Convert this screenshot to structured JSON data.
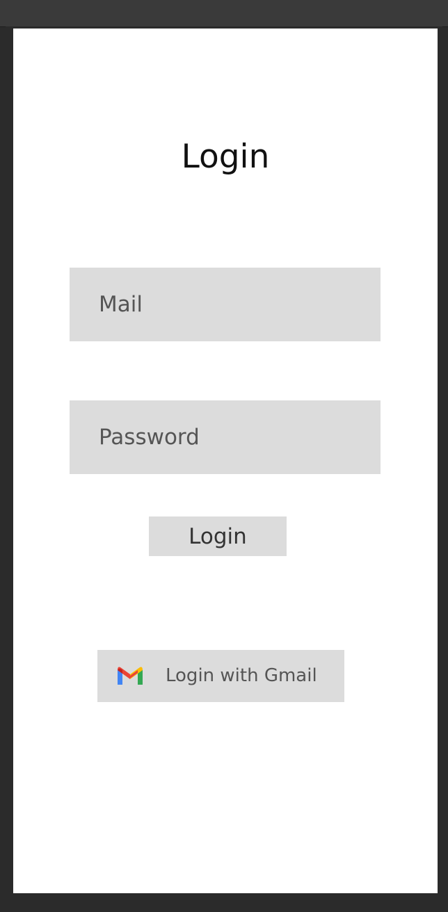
{
  "login_screen": {
    "title": "Login",
    "mail_placeholder": "Mail",
    "password_placeholder": "Password",
    "login_button_label": "Login",
    "gmail_button_label": "Login with Gmail",
    "gmail_icon": "gmail-icon"
  },
  "colors": {
    "field_background": "#dcdcdc",
    "screen_background": "#ffffff",
    "frame_background": "#2b2b2b"
  }
}
